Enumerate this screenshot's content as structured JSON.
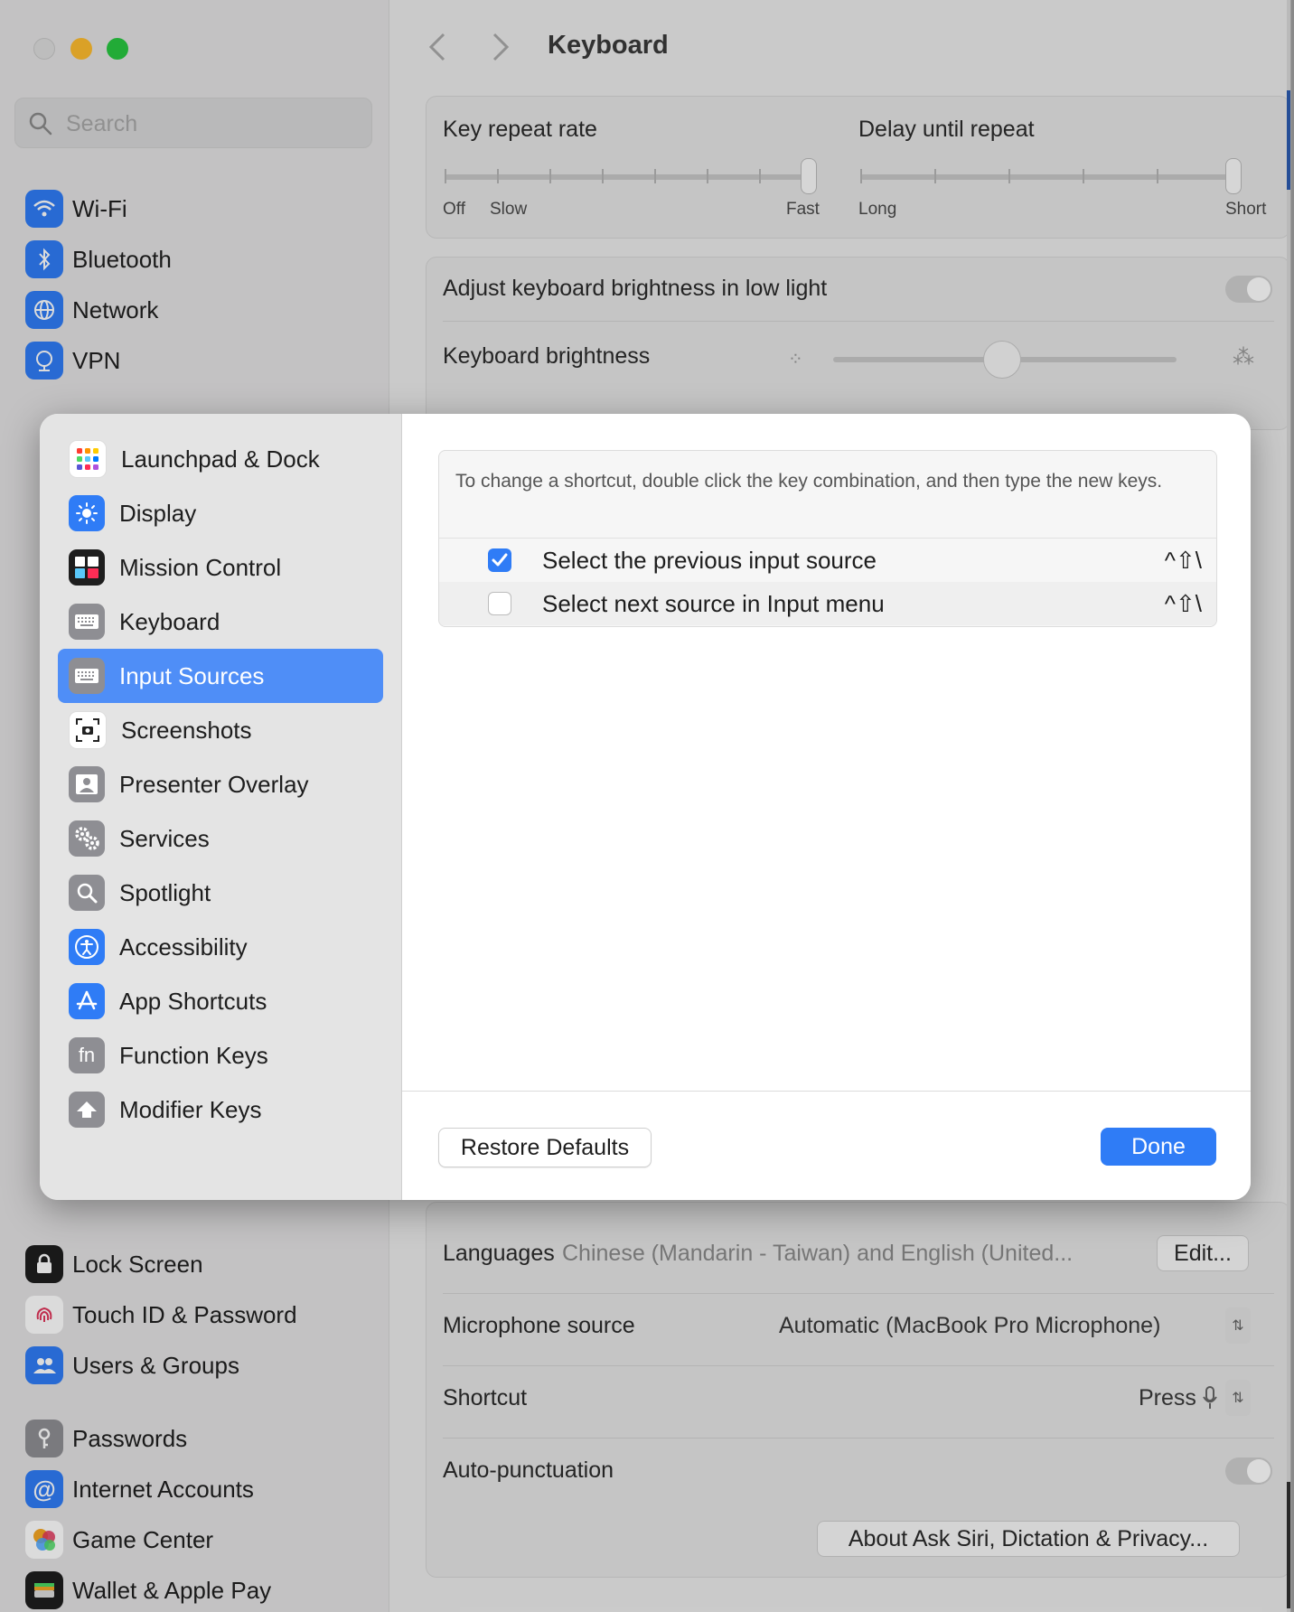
{
  "window": {
    "title": "Keyboard",
    "search_placeholder": "Search"
  },
  "sidebar": {
    "top_items": [
      {
        "label": "Wi-Fi",
        "icon": "wifi-icon"
      },
      {
        "label": "Bluetooth",
        "icon": "bluetooth-icon"
      },
      {
        "label": "Network",
        "icon": "network-icon"
      },
      {
        "label": "VPN",
        "icon": "vpn-icon"
      }
    ],
    "bottom_items": [
      {
        "label": "Lock Screen",
        "icon": "lock-icon"
      },
      {
        "label": "Touch ID & Password",
        "icon": "fingerprint-icon"
      },
      {
        "label": "Users & Groups",
        "icon": "users-icon"
      },
      {
        "label": "Passwords",
        "icon": "key-icon"
      },
      {
        "label": "Internet Accounts",
        "icon": "at-icon"
      },
      {
        "label": "Game Center",
        "icon": "game-center-icon"
      },
      {
        "label": "Wallet & Apple Pay",
        "icon": "wallet-icon"
      }
    ]
  },
  "keyboard": {
    "key_repeat_rate": {
      "label": "Key repeat rate",
      "min": "Off",
      "second": "Slow",
      "max": "Fast"
    },
    "delay_until_repeat": {
      "label": "Delay until repeat",
      "min": "Long",
      "max": "Short"
    },
    "adjust_brightness_label": "Adjust keyboard brightness in low light",
    "keyboard_brightness_label": "Keyboard brightness",
    "languages": {
      "label": "Languages",
      "value": "Chinese (Mandarin - Taiwan) and English (United...",
      "button": "Edit..."
    },
    "microphone": {
      "label": "Microphone source",
      "value": "Automatic (MacBook Pro Microphone)"
    },
    "shortcut": {
      "label": "Shortcut",
      "value": "Press"
    },
    "auto_punctuation_label": "Auto-punctuation",
    "about_button": "About Ask Siri, Dictation & Privacy..."
  },
  "sheet": {
    "categories": [
      {
        "label": "Launchpad & Dock",
        "icon": "launchpad-icon",
        "color": "#ffffff"
      },
      {
        "label": "Display",
        "icon": "display-icon",
        "color": "#2f7cf6"
      },
      {
        "label": "Mission Control",
        "icon": "mission-control-icon",
        "color": "#1e1e1e"
      },
      {
        "label": "Keyboard",
        "icon": "keyboard-icon",
        "color": "#8e8e93"
      },
      {
        "label": "Input Sources",
        "icon": "keyboard-icon",
        "color": "#8e8e93"
      },
      {
        "label": "Screenshots",
        "icon": "screenshot-icon",
        "color": "#ffffff"
      },
      {
        "label": "Presenter Overlay",
        "icon": "presenter-icon",
        "color": "#8e8e93"
      },
      {
        "label": "Services",
        "icon": "gears-icon",
        "color": "#8e8e93"
      },
      {
        "label": "Spotlight",
        "icon": "magnifier-icon",
        "color": "#8e8e93"
      },
      {
        "label": "Accessibility",
        "icon": "accessibility-icon",
        "color": "#2f7cf6"
      },
      {
        "label": "App Shortcuts",
        "icon": "app-store-icon",
        "color": "#2f7cf6"
      },
      {
        "label": "Function Keys",
        "icon": "fn-icon",
        "color": "#8e8e93"
      },
      {
        "label": "Modifier Keys",
        "icon": "up-arrow-icon",
        "color": "#8e8e93"
      }
    ],
    "selected_category": "Input Sources",
    "hint": "To change a shortcut, double click the key combination, and then type the new keys.",
    "shortcuts": [
      {
        "label": "Select the previous input source",
        "keys": "^⇧\\",
        "checked": true
      },
      {
        "label": "Select next source in Input menu",
        "keys": "^⇧\\",
        "checked": false
      }
    ],
    "restore_button": "Restore Defaults",
    "done_button": "Done"
  },
  "colors": {
    "accent": "#2f7cf6",
    "selection": "#4f8ef7"
  }
}
